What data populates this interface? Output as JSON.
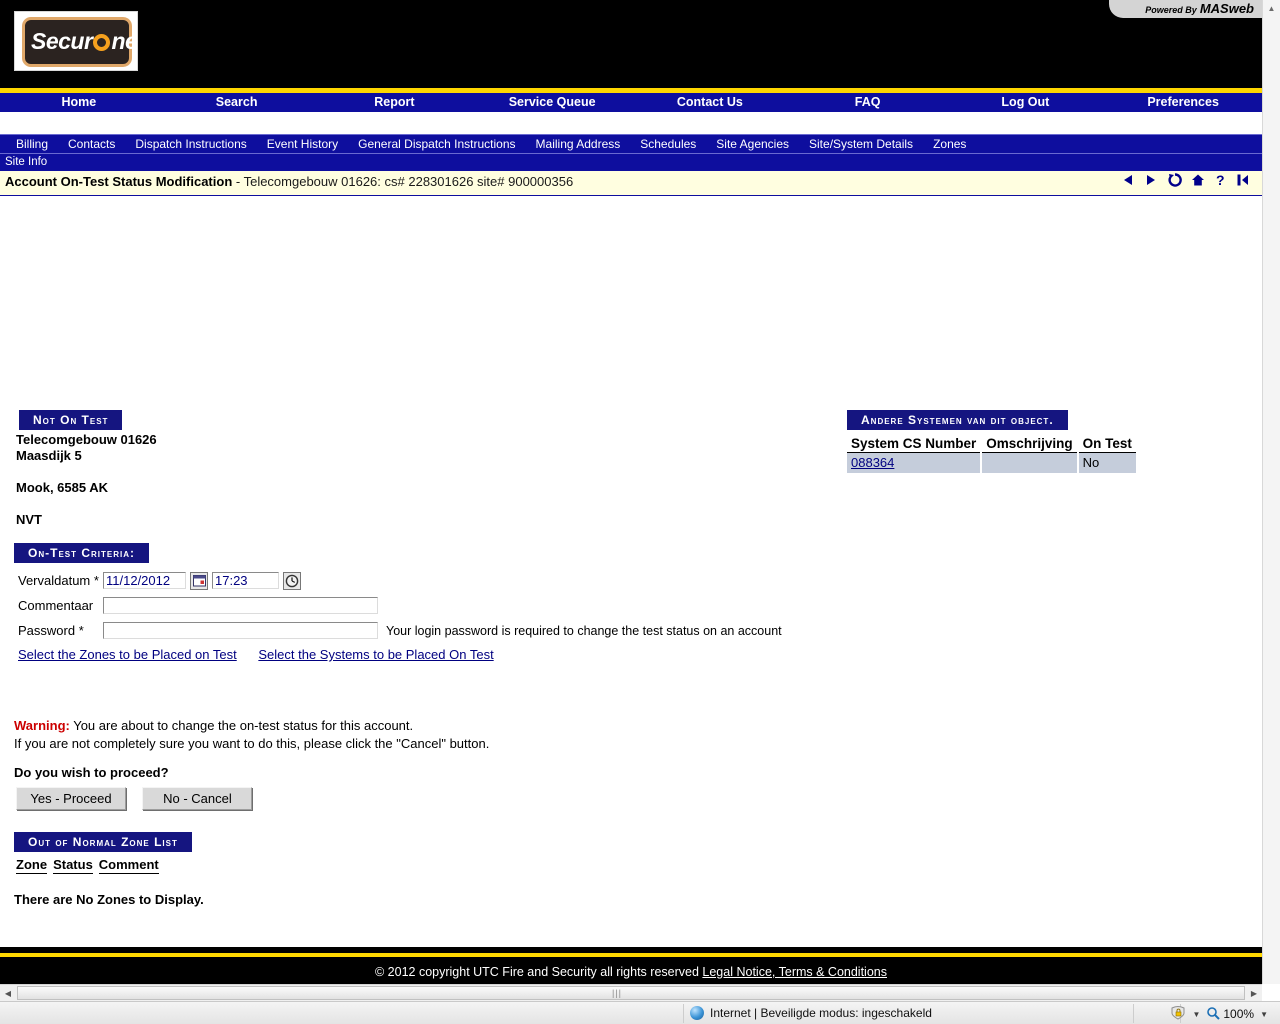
{
  "header": {
    "logo_text_1": "Secur",
    "logo_text_2": "ne",
    "powered_small": "Powered By",
    "powered_big": "MASweb"
  },
  "mainnav": [
    {
      "label": "Home"
    },
    {
      "label": "Search"
    },
    {
      "label": "Report"
    },
    {
      "label": "Service Queue"
    },
    {
      "label": "Contact Us"
    },
    {
      "label": "FAQ"
    },
    {
      "label": "Log Out"
    },
    {
      "label": "Preferences"
    }
  ],
  "subnav": [
    {
      "label": "Billing"
    },
    {
      "label": "Contacts"
    },
    {
      "label": "Dispatch Instructions"
    },
    {
      "label": "Event History"
    },
    {
      "label": "General Dispatch Instructions"
    },
    {
      "label": "Mailing Address"
    },
    {
      "label": "Schedules"
    },
    {
      "label": "Site Agencies"
    },
    {
      "label": "Site/System Details"
    },
    {
      "label": "Zones"
    }
  ],
  "siteinfo_label": "Site Info",
  "titlebar": {
    "title": "Account On-Test Status Modification",
    "detail": " - Telecomgebouw 01626: cs# 228301626  site# 900000356",
    "icons": [
      {
        "name": "back-icon",
        "glyph": "◀"
      },
      {
        "name": "forward-icon",
        "glyph": "▶"
      },
      {
        "name": "refresh-icon",
        "glyph": "↻"
      },
      {
        "name": "home-icon",
        "glyph": "⌂"
      },
      {
        "name": "help-icon",
        "glyph": "?"
      },
      {
        "name": "exit-icon",
        "glyph": "⏴"
      }
    ]
  },
  "account": {
    "status_badge": "Not On Test",
    "name": "Telecomgebouw 01626",
    "street": "Maasdijk 5",
    "city_zip": "Mook,  6585 AK",
    "extra": "NVT"
  },
  "criteria": {
    "badge": "On-Test Criteria:",
    "expiry_label": "Vervaldatum *",
    "expiry_date": "11/12/2012",
    "expiry_time": "17:23",
    "comment_label": "Commentaar",
    "comment_value": "",
    "comment_placeholder": "",
    "password_label": "Password *",
    "password_value": "",
    "password_placeholder": "",
    "password_hint": "Your login password is required to change the test status on an account",
    "link_zones": "Select the Zones to be Placed on Test",
    "link_systems": "Select the Systems to be Placed On Test"
  },
  "warning": {
    "label": "Warning:",
    "line1": " You are about to change the on-test status for this account.",
    "line2": "If you are not completely sure you want to do this, please click the \"Cancel\" button.",
    "question": "Do you wish to proceed?",
    "btn_yes": "Yes - Proceed",
    "btn_no": "No - Cancel"
  },
  "zone_list": {
    "badge": "Out of Normal Zone List",
    "col_zone": "Zone",
    "col_status": "Status",
    "col_comment": "Comment",
    "empty_message": "There are No Zones to Display."
  },
  "other_systems": {
    "badge": "Andere Systemen van dit object.",
    "columns": [
      "System CS Number",
      "Omschrijving",
      "On Test"
    ],
    "rows": [
      {
        "cs_number": "088364",
        "omschrijving": "",
        "on_test": "No"
      }
    ]
  },
  "footer": {
    "copyright": "© 2012 copyright UTC Fire and Security all rights reserved",
    "legal_link": "Legal Notice, Terms & Conditions"
  },
  "browser_status": {
    "zone_text": "Internet | Beveiligde modus: ingeschakeld",
    "zoom_level": "100%"
  },
  "colors": {
    "nav_blue": "#0e0e9e",
    "badge_blue": "#151580",
    "accent_yellow": "#ffd700",
    "title_band": "#fffee0",
    "warning_red": "#cc0000",
    "link_blue": "#000080",
    "table_cell": "#c5cddb"
  }
}
